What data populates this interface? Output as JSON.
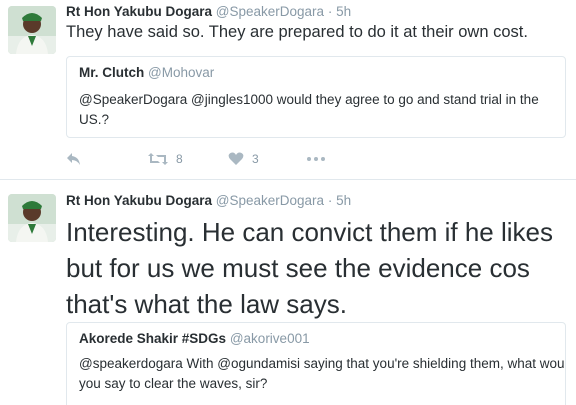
{
  "tweets": [
    {
      "author_name": "Rt Hon Yakubu Dogara",
      "author_handle": "@SpeakerDogara",
      "separator": "·",
      "time": "5h",
      "text": "They have said so. They are prepared to do it at their own cost.",
      "quote": {
        "author_name": "Mr. Clutch",
        "author_handle": "@Mohovar",
        "text": "@SpeakerDogara @jingles1000 would they agree to go and stand trial in the US.?"
      },
      "actions": {
        "retweet_count": "8",
        "like_count": "3"
      }
    },
    {
      "author_name": "Rt Hon Yakubu Dogara",
      "author_handle": "@SpeakerDogara",
      "separator": "·",
      "time": "5h",
      "text": "Interesting. He can convict them if he likes but for us we must see the evidence cos that's what the law says.",
      "quote": {
        "author_name": "Akorede Shakir #SDGs",
        "author_handle": "@akorive001",
        "text": "@speakerdogara With @ogundamisi saying that you're shielding them, what would you say to clear the waves, sir?"
      }
    }
  ],
  "icons": {
    "reply": "reply-icon",
    "retweet": "retweet-icon",
    "like": "heart-icon",
    "more": "more-icon"
  },
  "colors": {
    "text": "#292f33",
    "secondary": "#8899a6",
    "icon": "#aab8c2",
    "border": "#e1e8ed"
  }
}
